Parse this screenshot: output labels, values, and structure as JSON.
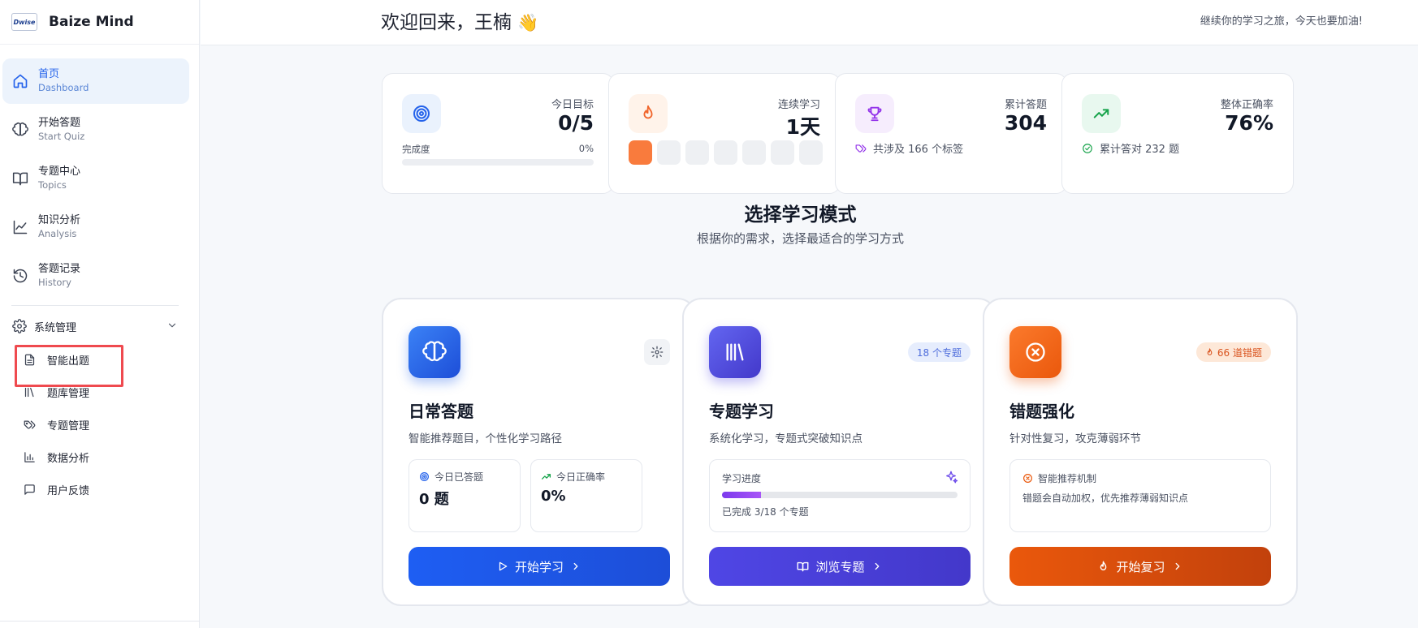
{
  "brand": {
    "logo_text": "Dwise",
    "name": "Baize Mind"
  },
  "nav": [
    {
      "zh": "首页",
      "en": "Dashboard"
    },
    {
      "zh": "开始答题",
      "en": "Start Quiz"
    },
    {
      "zh": "专题中心",
      "en": "Topics"
    },
    {
      "zh": "知识分析",
      "en": "Analysis"
    },
    {
      "zh": "答题记录",
      "en": "History"
    }
  ],
  "system": {
    "label": "系统管理",
    "items": [
      "智能出题",
      "题库管理",
      "专题管理",
      "数据分析",
      "用户反馈"
    ]
  },
  "header": {
    "welcome": "欢迎回来，王楠",
    "wave": "👋",
    "tagline": "继续你的学习之旅，今天也要加油!"
  },
  "stats": {
    "goal": {
      "label": "今日目标",
      "value": "0/5",
      "progress_label": "完成度",
      "progress_pct": "0%",
      "progress": 0
    },
    "streak": {
      "label": "连续学习",
      "value": "1天",
      "days_total": 7,
      "days_active": 1
    },
    "total": {
      "label": "累计答题",
      "value": "304",
      "foot": "共涉及 166 个标签"
    },
    "accuracy": {
      "label": "整体正确率",
      "value": "76%",
      "foot": "累计答对 232 题"
    }
  },
  "section": {
    "title": "选择学习模式",
    "subtitle": "根据你的需求，选择最适合的学习方式"
  },
  "modes": {
    "daily": {
      "title": "日常答题",
      "desc": "智能推荐题目，个性化学习路径",
      "mini1_label": "今日已答题",
      "mini1_value": "0 题",
      "mini2_label": "今日正确率",
      "mini2_value": "0%",
      "cta": "开始学习"
    },
    "topic": {
      "title": "专题学习",
      "desc": "系统化学习，专题式突破知识点",
      "badge": "18 个专题",
      "progress_label": "学习进度",
      "progress": 0.167,
      "done": "已完成 3/18 个专题",
      "cta": "浏览专题"
    },
    "wrong": {
      "title": "错题强化",
      "desc": "针对性复习，攻克薄弱环节",
      "badge": "66 道错题",
      "box_title": "智能推荐机制",
      "box_text": "错题会自动加权，优先推荐薄弱知识点",
      "cta": "开始复习"
    }
  },
  "colors": {
    "accent": "#2563eb",
    "purple": "#4f46e5",
    "orange": "#ea580c",
    "highlight": "#ef4a4f"
  }
}
